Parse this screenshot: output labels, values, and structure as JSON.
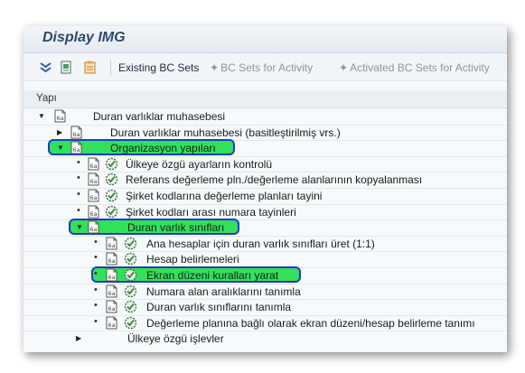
{
  "window": {
    "title": "Display IMG"
  },
  "toolbar": {
    "icons": [
      "expand-icon",
      "find-icon",
      "note-icon"
    ],
    "buttons": [
      {
        "label": "Existing BC Sets",
        "enabled": true
      },
      {
        "label": "BC Sets for Activity",
        "enabled": false,
        "icon": "bc-set-icon"
      },
      {
        "label": "Activated BC Sets for Activity",
        "enabled": false,
        "icon": "bc-set-icon"
      }
    ]
  },
  "tree": {
    "header": "Yapı",
    "nodes": [
      {
        "label": "Duran varlıklar muhasebesi",
        "toggle": "expanded",
        "activity": false,
        "highlighted": false
      },
      {
        "label": "Duran varlıklar muhasebesi (basitleştirilmiş vrs.)",
        "toggle": "collapsed",
        "activity": false,
        "highlighted": false
      },
      {
        "label": "Organizasyon yapıları",
        "toggle": "expanded",
        "activity": false,
        "highlighted": true
      },
      {
        "label": "Ülkeye özgü ayarların kontrolü",
        "toggle": "leaf",
        "activity": true,
        "highlighted": false
      },
      {
        "label": "Referans değerleme pln./değerleme alanlarının kopyalanması",
        "toggle": "leaf",
        "activity": true,
        "highlighted": false
      },
      {
        "label": "Şirket kodlarına değerleme planları tayini",
        "toggle": "leaf",
        "activity": true,
        "highlighted": false
      },
      {
        "label": "Şirket kodları arası numara tayinleri",
        "toggle": "leaf",
        "activity": true,
        "highlighted": false
      },
      {
        "label": "Duran varlık sınıfları",
        "toggle": "expanded",
        "activity": false,
        "highlighted": true
      },
      {
        "label": "Ana hesaplar için duran varlık sınıfları üret (1:1)",
        "toggle": "leaf",
        "activity": true,
        "highlighted": false
      },
      {
        "label": "Hesap belirlemeleri",
        "toggle": "leaf",
        "activity": true,
        "highlighted": false
      },
      {
        "label": "Ekran düzeni kuralları yarat",
        "toggle": "leaf",
        "activity": true,
        "highlighted": true
      },
      {
        "label": "Numara alan aralıklarını tanımla",
        "toggle": "leaf",
        "activity": true,
        "highlighted": false
      },
      {
        "label": "Duran varlık sınıflarını tanımla",
        "toggle": "leaf",
        "activity": true,
        "highlighted": false
      },
      {
        "label": "Değerleme planına bağlı olarak ekran düzeni/hesap belirleme tanımı",
        "toggle": "leaf",
        "activity": true,
        "highlighted": false
      },
      {
        "label": "Ülkeye özgü işlevler",
        "toggle": "collapsed",
        "activity": false,
        "highlighted": false
      }
    ]
  },
  "colors": {
    "highlight_fill": "#32e05a",
    "highlight_border": "#1a3dcc",
    "title_text": "#2c4a67"
  }
}
